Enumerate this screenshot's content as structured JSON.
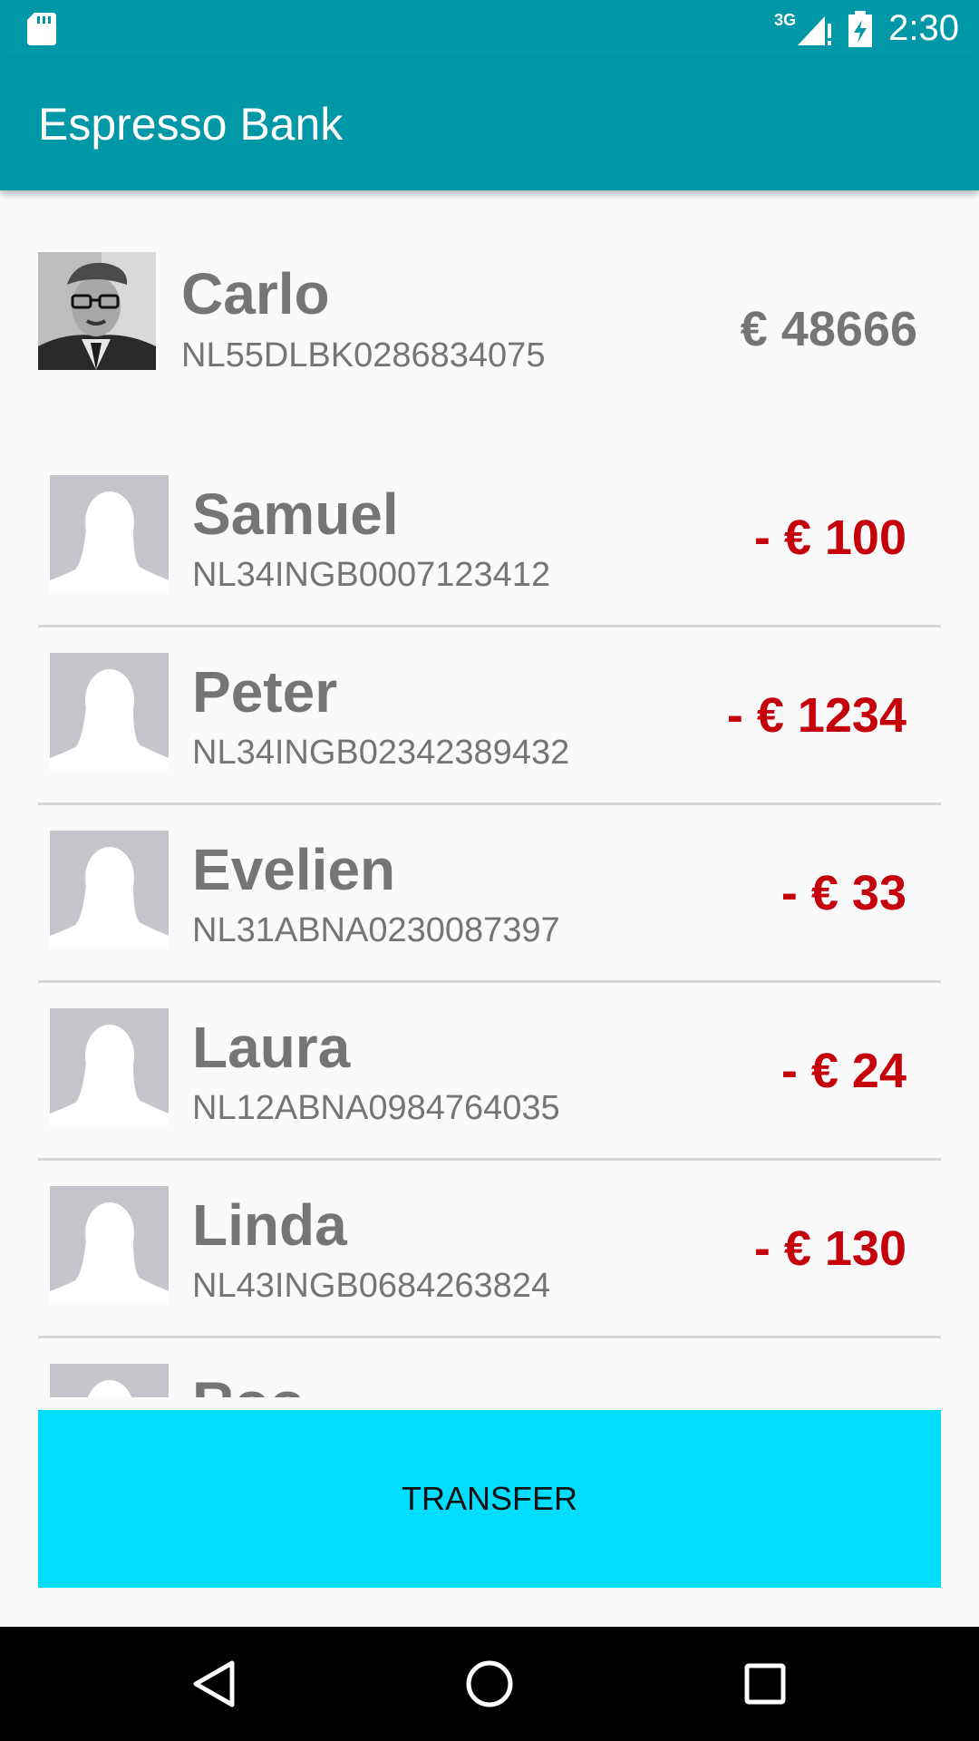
{
  "status_bar": {
    "network": "3G",
    "time": "2:30",
    "icons": [
      "sd-card-icon",
      "signal-icon",
      "battery-charging-icon"
    ]
  },
  "app_bar": {
    "title": "Espresso Bank"
  },
  "account": {
    "name": "Carlo",
    "iban": "NL55DLBK0286834075",
    "balance": "€ 48666",
    "avatar_icon": "profile-photo"
  },
  "transactions": [
    {
      "name": "Samuel",
      "iban": "NL34INGB0007123412",
      "amount": "- € 100"
    },
    {
      "name": "Peter",
      "iban": "NL34INGB02342389432",
      "amount": "- € 1234"
    },
    {
      "name": "Evelien",
      "iban": "NL31ABNA0230087397",
      "amount": "- € 33"
    },
    {
      "name": "Laura",
      "iban": "NL12ABNA0984764035",
      "amount": "- € 24"
    },
    {
      "name": "Linda",
      "iban": "NL43INGB0684263824",
      "amount": "- € 130"
    },
    {
      "name": "Roo",
      "iban": "",
      "amount": ""
    }
  ],
  "actions": {
    "transfer_label": "TRANSFER"
  },
  "nav_bar": {
    "icons": [
      "back-icon",
      "home-icon",
      "recents-icon"
    ]
  },
  "colors": {
    "primary": "#0097a7",
    "accent": "#00ddff",
    "negative_amount": "#c4000b",
    "text_secondary": "#757575"
  }
}
